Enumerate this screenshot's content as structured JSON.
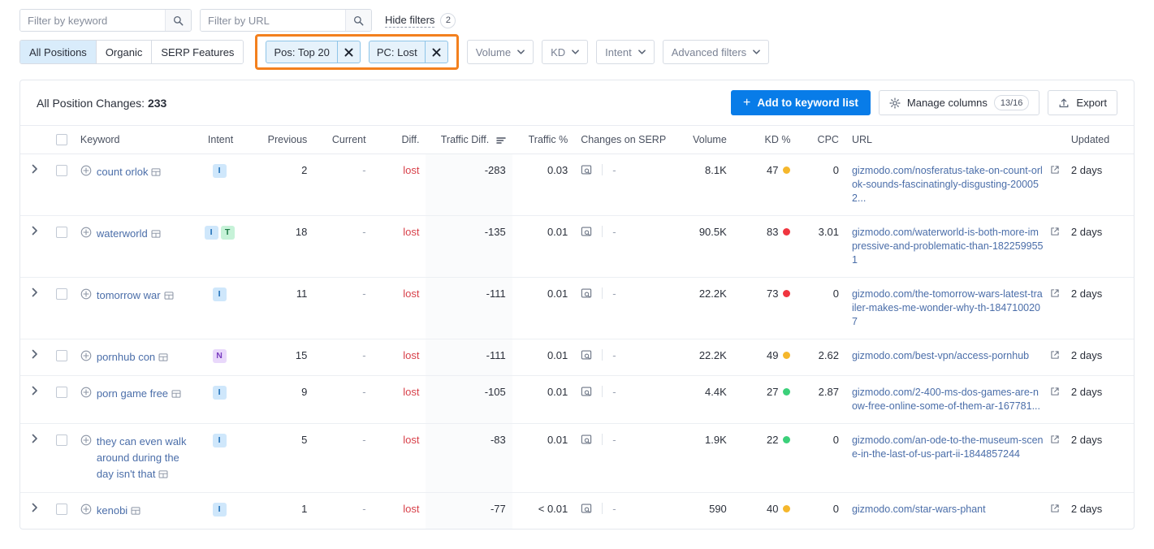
{
  "filters": {
    "keyword_search_placeholder": "Filter by keyword",
    "url_search_placeholder": "Filter by URL",
    "keyword_search_value": "",
    "url_search_value": "",
    "hide_filters_label": "Hide filters",
    "hide_filters_count": "2",
    "segments": [
      {
        "label": "All Positions",
        "active": true
      },
      {
        "label": "Organic",
        "active": false
      },
      {
        "label": "SERP Features",
        "active": false
      }
    ],
    "chips": [
      {
        "label": "Pos: Top 20"
      },
      {
        "label": "PC: Lost"
      }
    ],
    "dropdowns": [
      {
        "label": "Volume"
      },
      {
        "label": "KD"
      },
      {
        "label": "Intent"
      },
      {
        "label": "Advanced filters"
      }
    ],
    "highlight_color": "#f3801e"
  },
  "card": {
    "title_prefix": "All Position Changes: ",
    "title_count": "233",
    "add_to_keyword_list_label": "Add to keyword list",
    "manage_columns_label": "Manage columns",
    "manage_columns_ratio": "13/16",
    "export_label": "Export",
    "primary_color": "#087ce8"
  },
  "table": {
    "columns": [
      {
        "key": "keyword",
        "label": "Keyword",
        "align": "left"
      },
      {
        "key": "intent",
        "label": "Intent",
        "align": "center"
      },
      {
        "key": "previous",
        "label": "Previous",
        "align": "right"
      },
      {
        "key": "current",
        "label": "Current",
        "align": "right"
      },
      {
        "key": "diff",
        "label": "Diff.",
        "align": "right"
      },
      {
        "key": "traffic_diff",
        "label": "Traffic Diff.",
        "align": "right",
        "sorted": true
      },
      {
        "key": "traffic_pct",
        "label": "Traffic %",
        "align": "right"
      },
      {
        "key": "changes_on_serp",
        "label": "Changes on SERP",
        "align": "left"
      },
      {
        "key": "volume",
        "label": "Volume",
        "align": "right"
      },
      {
        "key": "kd",
        "label": "KD %",
        "align": "right"
      },
      {
        "key": "cpc",
        "label": "CPC",
        "align": "right"
      },
      {
        "key": "url",
        "label": "URL",
        "align": "left"
      },
      {
        "key": "updated",
        "label": "Updated",
        "align": "left"
      }
    ],
    "rows": [
      {
        "keyword": "count orlok",
        "intent": [
          "I"
        ],
        "previous": "2",
        "current": "-",
        "diff": "lost",
        "traffic_diff": "-283",
        "traffic_pct": "0.03",
        "volume": "8.1K",
        "kd": "47",
        "kd_color": "#f5b72c",
        "cpc": "0",
        "url": "gizmodo.com/nosferatus-take-on-count-orlok-sounds-fascinatingly-disgusting-200052...",
        "updated": "2 days"
      },
      {
        "keyword": "waterworld",
        "intent": [
          "I",
          "T"
        ],
        "previous": "18",
        "current": "-",
        "diff": "lost",
        "traffic_diff": "-135",
        "traffic_pct": "0.01",
        "volume": "90.5K",
        "kd": "83",
        "kd_color": "#f0353f",
        "cpc": "3.01",
        "url": "gizmodo.com/waterworld-is-both-more-impressive-and-problematic-than-1822599551",
        "updated": "2 days"
      },
      {
        "keyword": "tomorrow war",
        "intent": [
          "I"
        ],
        "previous": "11",
        "current": "-",
        "diff": "lost",
        "traffic_diff": "-111",
        "traffic_pct": "0.01",
        "volume": "22.2K",
        "kd": "73",
        "kd_color": "#f0353f",
        "cpc": "0",
        "url": "gizmodo.com/the-tomorrow-wars-latest-trailer-makes-me-wonder-why-th-1847100207",
        "updated": "2 days"
      },
      {
        "keyword": "pornhub con",
        "intent": [
          "N"
        ],
        "previous": "15",
        "current": "-",
        "diff": "lost",
        "traffic_diff": "-111",
        "traffic_pct": "0.01",
        "volume": "22.2K",
        "kd": "49",
        "kd_color": "#f5b72c",
        "cpc": "2.62",
        "url": "gizmodo.com/best-vpn/access-pornhub",
        "updated": "2 days"
      },
      {
        "keyword": "porn game free",
        "intent": [
          "I"
        ],
        "previous": "9",
        "current": "-",
        "diff": "lost",
        "traffic_diff": "-105",
        "traffic_pct": "0.01",
        "volume": "4.4K",
        "kd": "27",
        "kd_color": "#3bd07a",
        "cpc": "2.87",
        "url": "gizmodo.com/2-400-ms-dos-games-are-now-free-online-some-of-them-ar-167781...",
        "updated": "2 days"
      },
      {
        "keyword": "they can even walk around during the day isn't that",
        "intent": [
          "I"
        ],
        "previous": "5",
        "current": "-",
        "diff": "lost",
        "traffic_diff": "-83",
        "traffic_pct": "0.01",
        "volume": "1.9K",
        "kd": "22",
        "kd_color": "#3bd07a",
        "cpc": "0",
        "url": "gizmodo.com/an-ode-to-the-museum-scene-in-the-last-of-us-part-ii-1844857244",
        "updated": "2 days"
      },
      {
        "keyword": "kenobi",
        "intent": [
          "I"
        ],
        "previous": "1",
        "current": "-",
        "diff": "lost",
        "traffic_diff": "-77",
        "traffic_pct": "< 0.01",
        "volume": "590",
        "kd": "40",
        "kd_color": "#f5b72c",
        "cpc": "0",
        "url": "gizmodo.com/star-wars-phant",
        "updated": "2 days"
      }
    ]
  }
}
